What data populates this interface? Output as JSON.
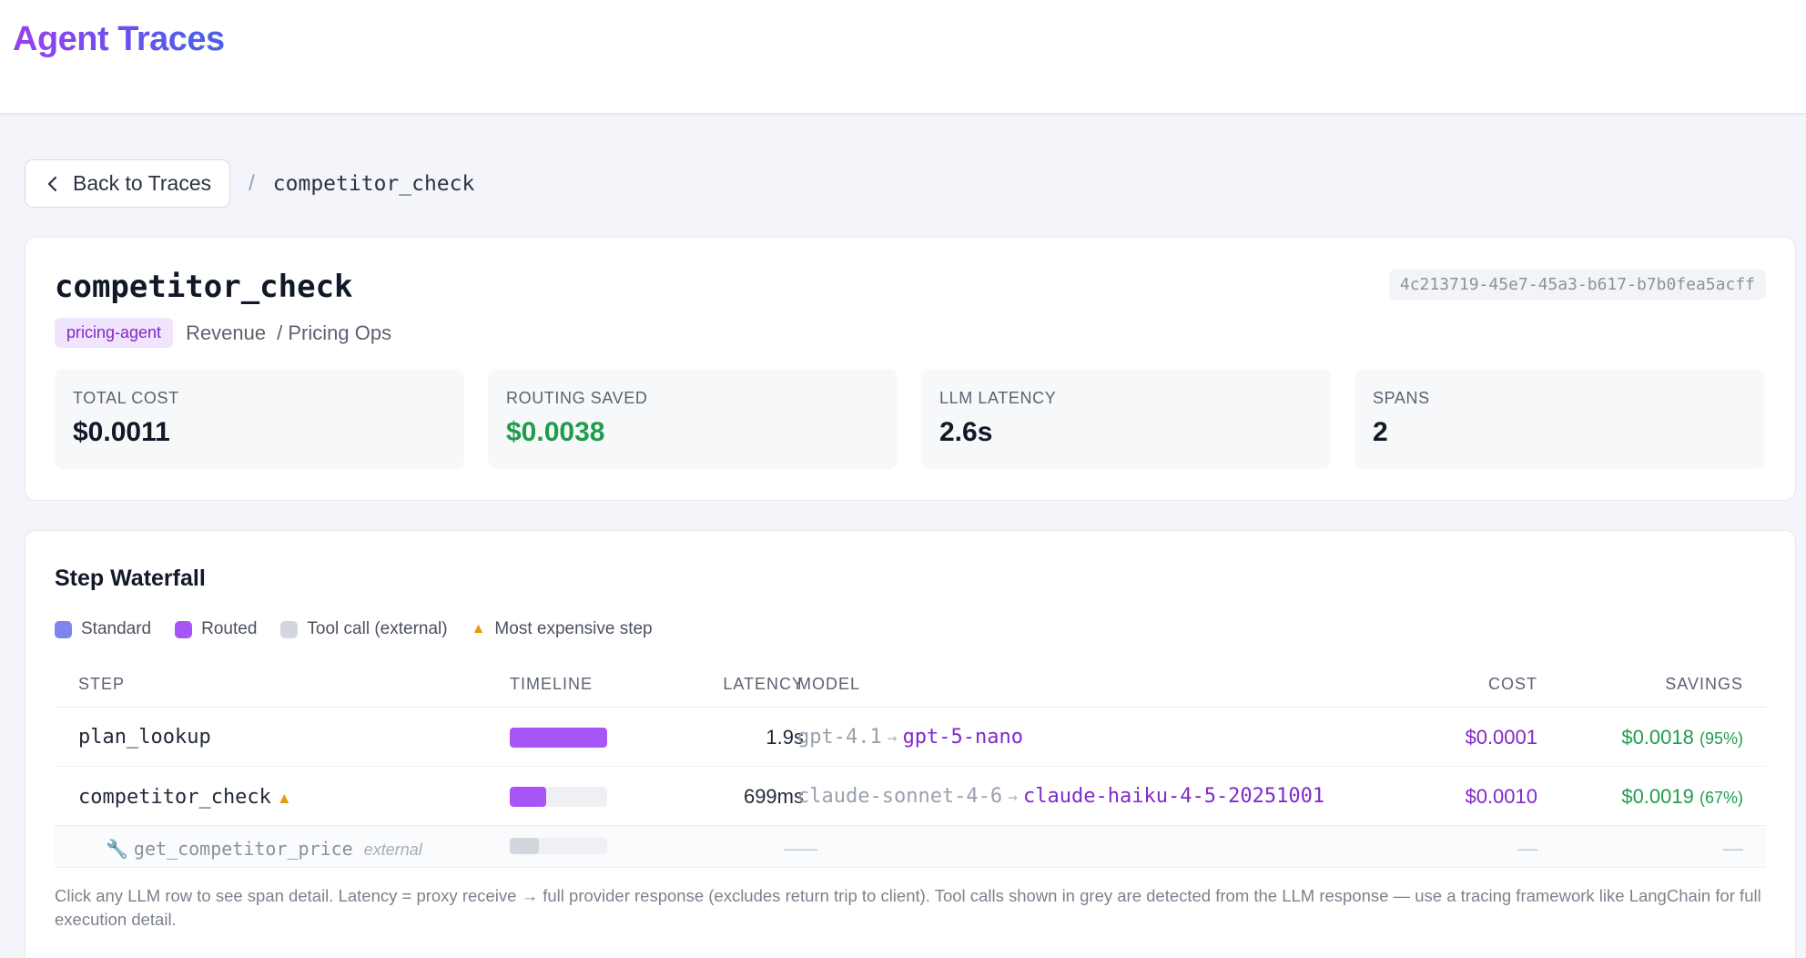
{
  "app": {
    "title": "Agent Traces"
  },
  "breadcrumb": {
    "back_label": "Back to Traces",
    "separator": "/",
    "current": "competitor_check"
  },
  "trace": {
    "name": "competitor_check",
    "id": "4c213719-45e7-45a3-b617-b7b0fea5acff",
    "agent_tag": "pricing-agent",
    "team": "Revenue",
    "subteam": "/ Pricing Ops"
  },
  "stats": [
    {
      "label": "TOTAL COST",
      "value": "$0.0011"
    },
    {
      "label": "ROUTING SAVED",
      "value": "$0.0038"
    },
    {
      "label": "LLM LATENCY",
      "value": "2.6s"
    },
    {
      "label": "SPANS",
      "value": "2"
    }
  ],
  "waterfall": {
    "title": "Step Waterfall",
    "legend": [
      {
        "label": "Standard",
        "color": "#7b86ee"
      },
      {
        "label": "Routed",
        "color": "#a855f7"
      },
      {
        "label": "Tool call (external)",
        "color": "#d4d6de"
      },
      {
        "label": "Most expensive step",
        "icon": "warning-triangle-icon"
      }
    ],
    "columns": {
      "step": "STEP",
      "timeline": "TIMELINE",
      "latency": "LATENCY",
      "model": "MODEL",
      "cost": "COST",
      "savings": "SAVINGS"
    },
    "rows": [
      {
        "step": "plan_lookup",
        "bar_start": 0,
        "bar_fraction": 1.0,
        "bar_color": "#a855f7",
        "latency": "1.9s",
        "model_from": "gpt-4.1",
        "arrow": "→",
        "model_to": "gpt-5-nano",
        "cost": "$0.0001",
        "savings": "$0.0018",
        "savings_pct": "(95%)"
      },
      {
        "step": "competitor_check",
        "bar_start": 0,
        "bar_fraction": 0.37,
        "bar_color": "#a855f7",
        "latency": "699ms",
        "model_from": "claude-sonnet-4-6",
        "arrow": "→",
        "model_to": "claude-haiku-4-5-20251001",
        "cost": "$0.0010",
        "savings": "$0.0019",
        "savings_pct": "(67%)"
      }
    ],
    "tool_row": {
      "name": "get_competitor_price",
      "tag": "external",
      "bar_fraction": 0.3,
      "bar_color": "#d4d6de",
      "latency": "—",
      "model": "—",
      "cost": "—",
      "savings": "—"
    },
    "footnote": "Click any LLM row to see span detail. Latency = proxy receive → full provider response (excludes return trip to client). Tool calls shown in grey are detected from the LLM response — use a tracing framework like LangChain for full execution detail."
  }
}
